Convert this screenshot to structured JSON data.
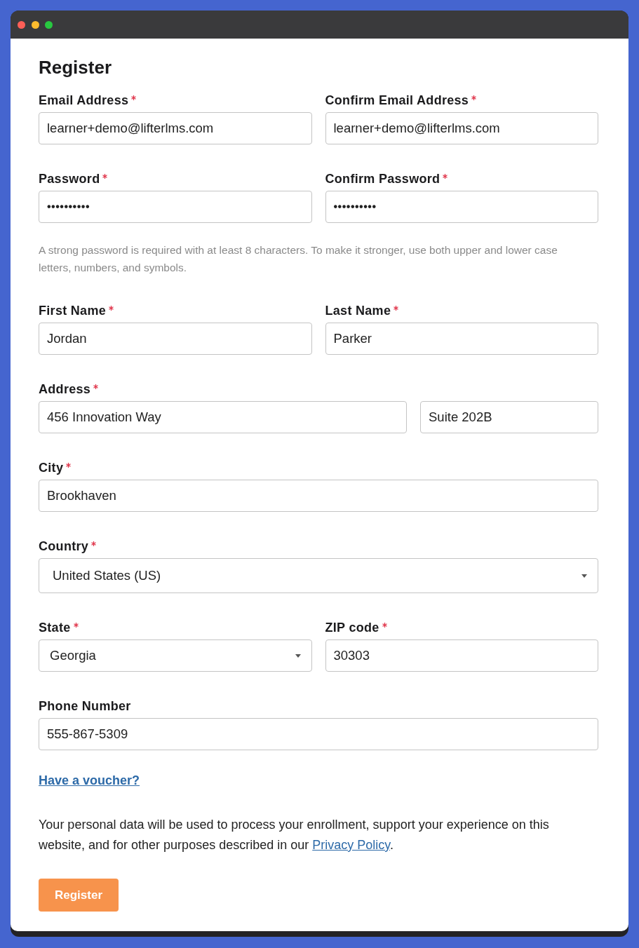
{
  "window": {
    "controls": [
      {
        "color": "#ff5f57"
      },
      {
        "color": "#febc2e"
      },
      {
        "color": "#28c840"
      }
    ]
  },
  "form": {
    "title": "Register",
    "rows": [
      {
        "kind": "pair",
        "fields": [
          {
            "label": "Email Address",
            "required": true,
            "kind": "text",
            "value": "learner+demo@lifterlms.com"
          },
          {
            "label": "Confirm Email Address",
            "required": true,
            "kind": "text",
            "value": "learner+demo@lifterlms.com"
          }
        ]
      },
      {
        "kind": "pair",
        "fields": [
          {
            "label": "Password",
            "required": true,
            "kind": "password",
            "value": "••••••••••"
          },
          {
            "label": "Confirm Password",
            "required": true,
            "kind": "password",
            "value": "••••••••••"
          }
        ],
        "hint": "A strong password is required with at least 8 characters. To make it stronger, use both upper and lower case letters, numbers, and symbols."
      },
      {
        "kind": "pair",
        "fields": [
          {
            "label": "First Name",
            "required": true,
            "kind": "text",
            "value": "Jordan"
          },
          {
            "label": "Last Name",
            "required": true,
            "kind": "text",
            "value": "Parker"
          }
        ]
      },
      {
        "kind": "address",
        "fields": [
          {
            "label": "Address",
            "required": true,
            "kind": "text",
            "value": "456 Innovation Way"
          },
          {
            "kind": "text",
            "value": "Suite 202B"
          }
        ]
      },
      {
        "kind": "full",
        "fields": [
          {
            "label": "City",
            "required": true,
            "kind": "text",
            "value": "Brookhaven"
          }
        ]
      },
      {
        "kind": "full",
        "fields": [
          {
            "label": "Country",
            "required": true,
            "kind": "select",
            "value": "United States (US)"
          }
        ]
      },
      {
        "kind": "pair",
        "fields": [
          {
            "label": "State",
            "required": true,
            "kind": "select",
            "value": "Georgia"
          },
          {
            "label": "ZIP code",
            "required": true,
            "kind": "text",
            "value": "30303"
          }
        ]
      },
      {
        "kind": "full",
        "fields": [
          {
            "label": "Phone Number",
            "required": false,
            "kind": "text",
            "value": "555-867-5309"
          }
        ]
      }
    ],
    "voucher_link": "Have a voucher?",
    "privacy_notice": {
      "text": "Your personal data will be used to process your enrollment, support your experience on this website, and for other purposes described in our ",
      "link": "Privacy Policy",
      "after": "."
    },
    "submit_button": "Register"
  }
}
